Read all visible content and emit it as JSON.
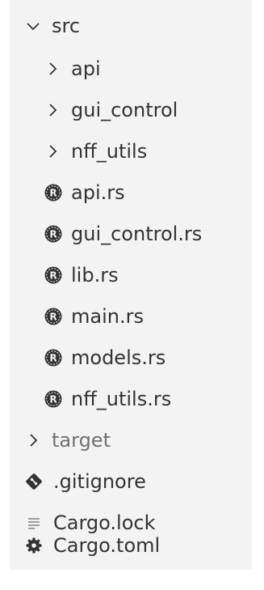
{
  "colors": {
    "panel_bg": "#f3f3f3",
    "text": "#333333",
    "dim_text": "#6f6f6f",
    "icon": "#333333",
    "lock_icon": "#8a8a8a"
  },
  "tree": {
    "src": {
      "label": "src",
      "icon": "chevron-down-icon"
    },
    "folders": [
      {
        "label": "api",
        "icon": "chevron-right-icon"
      },
      {
        "label": "gui_control",
        "icon": "chevron-right-icon"
      },
      {
        "label": "nff_utils",
        "icon": "chevron-right-icon"
      }
    ],
    "rust_files": [
      {
        "label": "api.rs",
        "icon": "rust-icon"
      },
      {
        "label": "gui_control.rs",
        "icon": "rust-icon"
      },
      {
        "label": "lib.rs",
        "icon": "rust-icon"
      },
      {
        "label": "main.rs",
        "icon": "rust-icon"
      },
      {
        "label": "models.rs",
        "icon": "rust-icon"
      },
      {
        "label": "nff_utils.rs",
        "icon": "rust-icon"
      }
    ],
    "target": {
      "label": "target",
      "icon": "chevron-right-icon"
    },
    "root_files": [
      {
        "label": ".gitignore",
        "icon": "git-icon"
      },
      {
        "label": "Cargo.lock",
        "icon": "lines-icon"
      },
      {
        "label": "Cargo.toml",
        "icon": "gear-icon"
      }
    ]
  }
}
